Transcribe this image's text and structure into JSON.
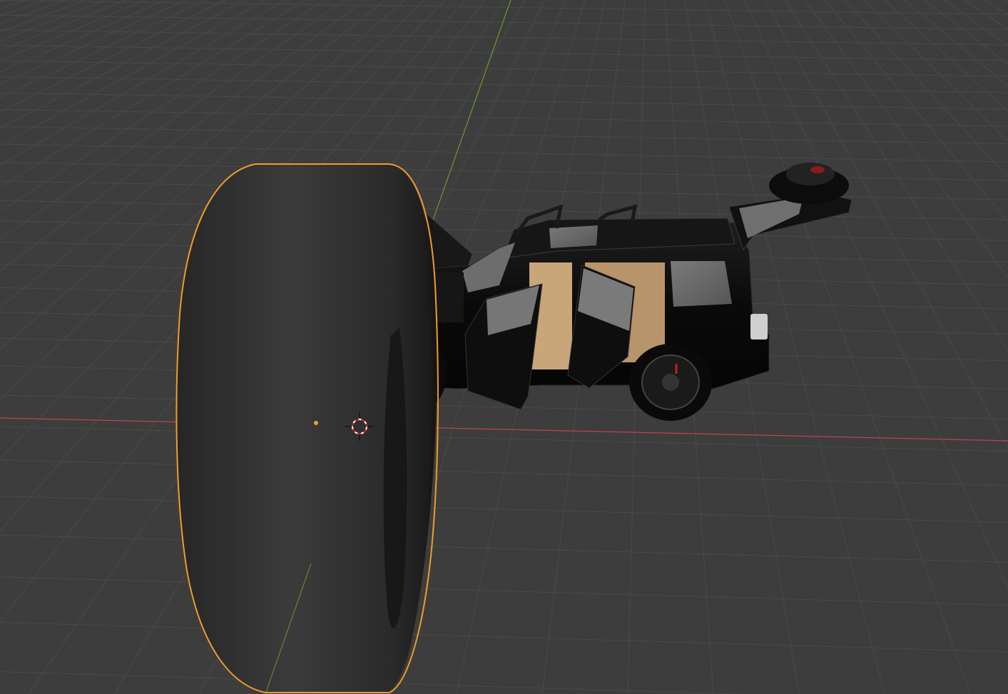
{
  "app": {
    "name": "3D viewport"
  },
  "viewport": {
    "background_color": "#3d3d3d",
    "grid_color": "#4a4a4a",
    "x_axis_color": "#c0424d",
    "y_axis_color": "#6b9a2f",
    "selection_outline_color": "#f09b2c"
  },
  "scene_objects": [
    {
      "name": "tire",
      "selected": true,
      "color": "#2a2a2a"
    },
    {
      "name": "suv",
      "selected": false,
      "color": "#0d0d0d",
      "interior_color": "#c9a57a"
    },
    {
      "name": "spare-tire-mount",
      "selected": false,
      "color": "#111111"
    }
  ],
  "cursor_3d": {
    "colors": [
      "#ffffff",
      "#d02020"
    ]
  }
}
